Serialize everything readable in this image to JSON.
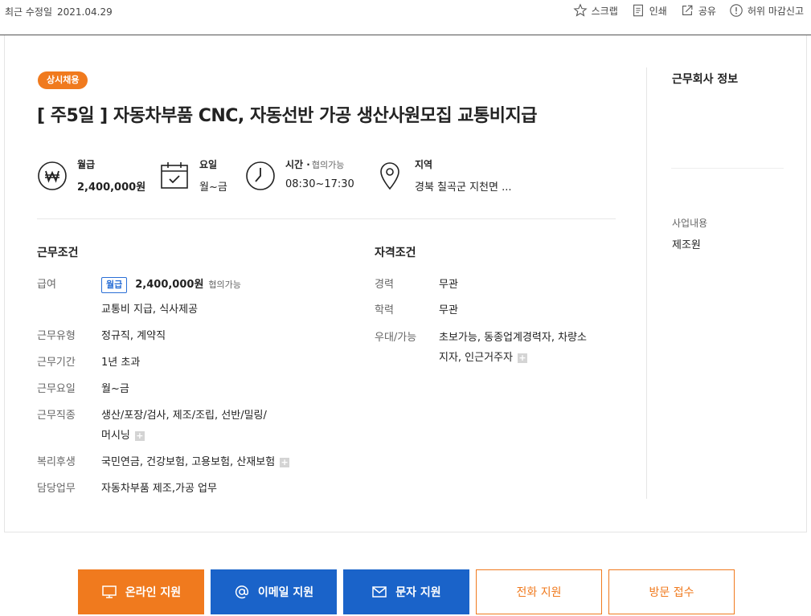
{
  "header": {
    "updated_label": "최근 수정일",
    "updated_date": "2021.04.29",
    "actions": {
      "scrap": "스크랩",
      "print": "인쇄",
      "share": "공유",
      "report": "허위 마감신고"
    }
  },
  "job": {
    "badge": "상시채용",
    "title": "[ 주5일 ] 자동차부품 CNC, 자동선반 가공 생산사원모집 교통비지급"
  },
  "summary": {
    "pay_label": "월급",
    "pay_value": "2,400,000원",
    "days_label": "요일",
    "days_value": "월~금",
    "time_label": "시간 ·",
    "time_sub": "협의가능",
    "time_value": "08:30~17:30",
    "region_label": "지역",
    "region_value": "경북 칠곡군 지천면 ..."
  },
  "conditions": {
    "title": "근무조건",
    "pay_key": "급여",
    "pay_tag": "월급",
    "pay_amount": "2,400,000원",
    "pay_note": "협의가능",
    "pay_extra": "교통비 지급, 식사제공",
    "type_key": "근무유형",
    "type_val": "정규직, 계약직",
    "period_key": "근무기간",
    "period_val": "1년 초과",
    "days_key": "근무요일",
    "days_val": "월~금",
    "job_key": "근무직종",
    "job_val_1": "생산/포장/검사, 제조/조립, 선반/밀링/",
    "job_val_2": "머시닝",
    "welfare_key": "복리후생",
    "welfare_val": "국민연금, 건강보험, 고용보험, 산재보험",
    "duty_key": "담당업무",
    "duty_val": "자동차부품 제조,가공 업무"
  },
  "qualifications": {
    "title": "자격조건",
    "career_key": "경력",
    "career_val": "무관",
    "edu_key": "학력",
    "edu_val": "무관",
    "pref_key": "우대/가능",
    "pref_val_1": "초보가능, 동종업계경력자, 차량소",
    "pref_val_2": "지자, 인근거주자"
  },
  "company": {
    "title": "근무회사 정보",
    "biz_key": "사업내용",
    "biz_val": "제조원"
  },
  "apply": {
    "online": "온라인 지원",
    "email": "이메일 지원",
    "sms": "문자 지원",
    "phone": "전화 지원",
    "visit": "방문 접수"
  },
  "colors": {
    "accent": "#f07a1e",
    "primary": "#1a63c9"
  }
}
